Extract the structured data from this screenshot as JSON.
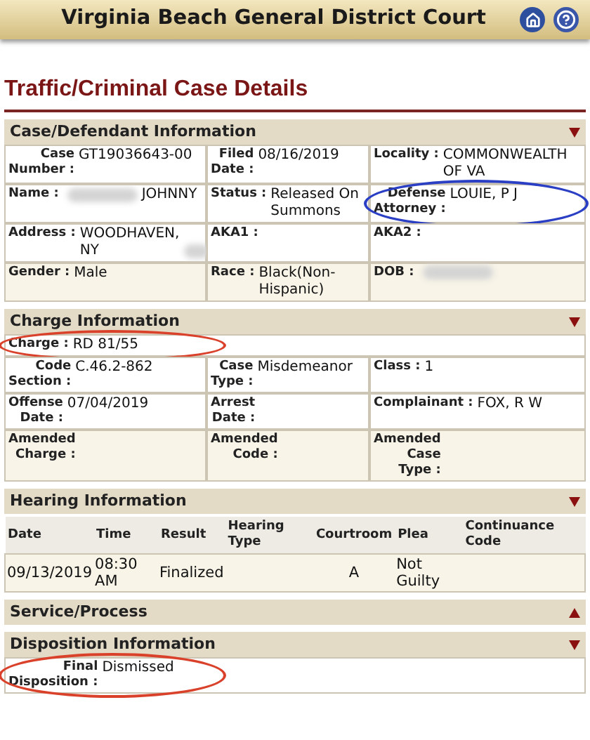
{
  "header": {
    "title": "Virginia Beach General District Court"
  },
  "page_title": "Traffic/Criminal Case Details",
  "sections": [
    {
      "kind": "fields",
      "title": "Case/Defendant Information",
      "expanded": true,
      "rows": [
        [
          {
            "label": "Case Number :",
            "value": "GT19036643-00"
          },
          {
            "label": "Filed Date :",
            "value": "08/16/2019"
          },
          {
            "label": "Locality :",
            "value": "COMMONWEALTH OF VA"
          }
        ],
        [
          {
            "label": "Name :",
            "value": "JOHNNY",
            "redacted_before": true
          },
          {
            "label": "Status :",
            "value": "Released On Summons"
          },
          {
            "label": "Defense Attorney :",
            "value": "LOUIE, P J",
            "circle": {
              "color": "#2a3fc4"
            }
          }
        ],
        [
          {
            "label": "Address :",
            "value": "WOODHAVEN, NY",
            "redacted_after": true
          },
          {
            "label": "AKA1 :"
          },
          {
            "label": "AKA2 :"
          }
        ],
        [
          {
            "label": "Gender :",
            "value": "Male"
          },
          {
            "label": "Race :",
            "value": "Black(Non-Hispanic)"
          },
          {
            "label": "DOB :",
            "redacted_after": true
          }
        ]
      ]
    },
    {
      "kind": "fields",
      "title": "Charge Information",
      "expanded": true,
      "rows": [
        [
          {
            "label": "Charge :",
            "value": "RD 81/55",
            "circle": {
              "color": "#d9412a"
            }
          }
        ],
        [
          {
            "label": "Code Section :",
            "value": "C.46.2-862"
          },
          {
            "label": "Case Type :",
            "value": "Misdemeanor"
          },
          {
            "label": "Class :",
            "value": "1"
          }
        ],
        [
          {
            "label": "Offense Date :",
            "value": "07/04/2019"
          },
          {
            "label": "Arrest Date :"
          },
          {
            "label": "Complainant :",
            "value": "FOX, R W"
          }
        ],
        [
          {
            "label": "Amended Charge :"
          },
          {
            "label": "Amended Code :"
          },
          {
            "label": "Amended Case Type :"
          }
        ]
      ]
    },
    {
      "kind": "table",
      "title": "Hearing Information",
      "expanded": true,
      "columns": [
        "Date",
        "Time",
        "Result",
        "Hearing Type",
        "Courtroom",
        "Plea",
        "Continuance Code"
      ],
      "rows": [
        [
          "09/13/2019",
          "08:30 AM",
          "Finalized",
          "",
          "A",
          "Not Guilty",
          ""
        ]
      ]
    },
    {
      "title": "Service/Process",
      "expanded": false
    },
    {
      "kind": "fields",
      "title": "Disposition Information",
      "expanded": true,
      "rows": [
        [
          {
            "label": "Final Disposition :",
            "value": "Dismissed",
            "circle": {
              "color": "#d9412a"
            }
          }
        ]
      ]
    }
  ]
}
